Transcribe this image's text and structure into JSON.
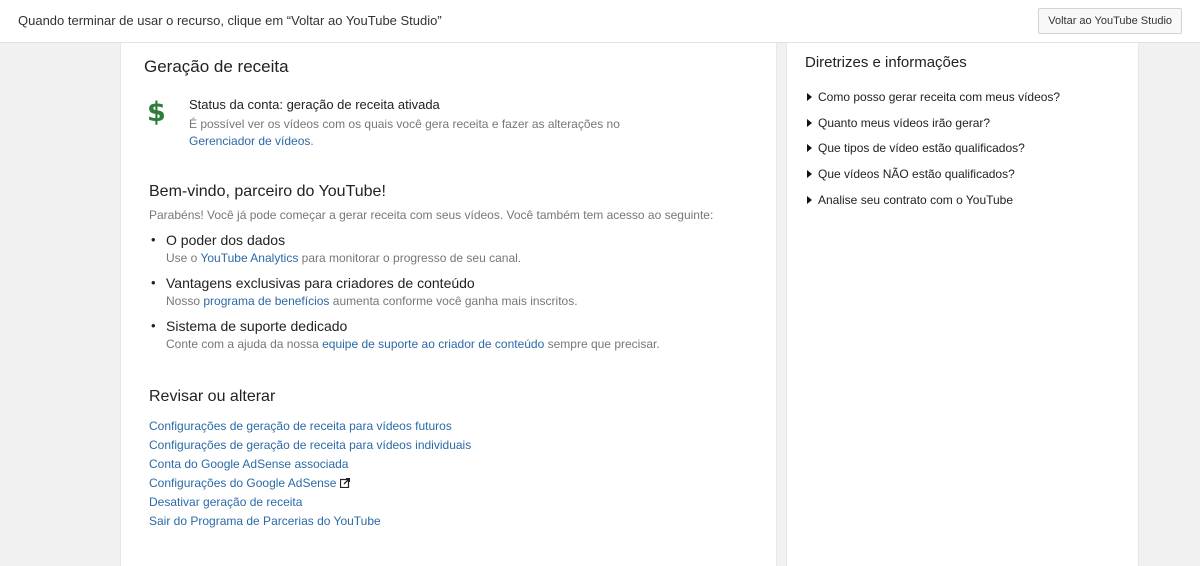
{
  "topbar": {
    "message": "Quando terminar de usar o recurso, clique em “Voltar ao YouTube Studio”",
    "button_label": "Voltar ao YouTube Studio"
  },
  "main": {
    "title": "Geração de receita",
    "status": {
      "icon": "dollar-icon",
      "icon_glyph": "$",
      "title": "Status da conta: geração de receita ativada",
      "desc_prefix": "É possível ver os vídeos com os quais você gera receita e fazer as alterações no",
      "desc_link": "Gerenciador de vídeos",
      "desc_suffix": "."
    },
    "welcome": {
      "title": "Bem-vindo, parceiro do YouTube!",
      "subtitle": "Parabéns! Você já pode começar a gerar receita com seus vídeos. Você também tem acesso ao seguinte:",
      "benefits": [
        {
          "title": "O poder dos dados",
          "prefix": "Use o ",
          "link": "YouTube Analytics",
          "suffix": " para monitorar o progresso de seu canal."
        },
        {
          "title": "Vantagens exclusivas para criadores de conteúdo",
          "prefix": "Nosso ",
          "link": "programa de benefícios",
          "suffix": " aumenta conforme você ganha mais inscritos."
        },
        {
          "title": "Sistema de suporte dedicado",
          "prefix": "Conte com a ajuda da nossa ",
          "link": "equipe de suporte ao criador de conteúdo",
          "suffix": " sempre que precisar."
        }
      ]
    },
    "review": {
      "title": "Revisar ou alterar",
      "links": [
        "Configurações de geração de receita para vídeos futuros",
        "Configurações de geração de receita para vídeos individuais",
        "Conta do Google AdSense associada",
        "Configurações do Google AdSense",
        "Desativar geração de receita",
        "Sair do Programa de Parcerias do YouTube"
      ]
    }
  },
  "sidebar": {
    "title": "Diretrizes e informações",
    "items": [
      "Como posso gerar receita com meus vídeos?",
      "Quanto meus vídeos irão gerar?",
      "Que tipos de vídeo estão qualificados?",
      "Que vídeos NÃO estão qualificados?",
      "Analise seu contrato com o YouTube"
    ]
  },
  "colors": {
    "link": "#2b6aa8",
    "dollar": "#2f7d3b"
  }
}
